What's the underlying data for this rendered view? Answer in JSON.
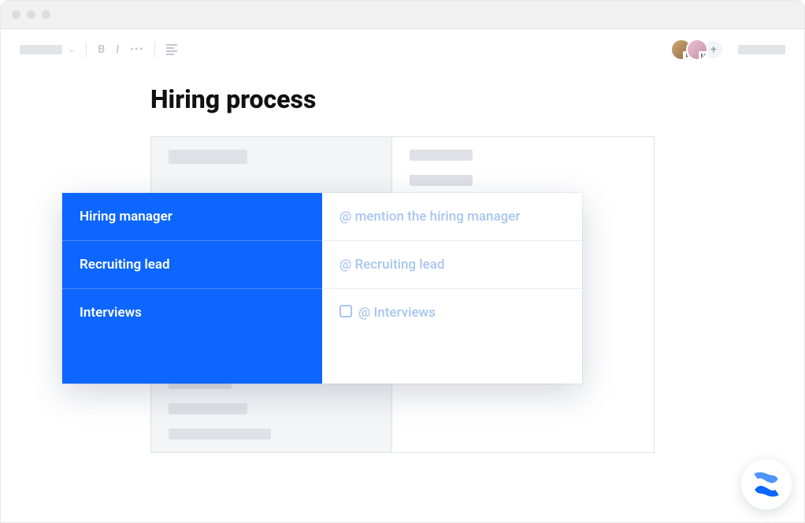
{
  "page": {
    "title": "Hiring process"
  },
  "toolbar": {
    "bold": "B",
    "italic": "I"
  },
  "collaborators": [
    {
      "initial": "R"
    },
    {
      "initial": "M"
    }
  ],
  "collaborator_add": "+",
  "overlay": {
    "rows": [
      {
        "label": "Hiring manager",
        "placeholder": "@ mention the hiring manager",
        "checkbox": false
      },
      {
        "label": "Recruiting lead",
        "placeholder": "@ Recruiting lead",
        "checkbox": false
      },
      {
        "label": "Interviews",
        "placeholder": "@ Interviews",
        "checkbox": true
      }
    ]
  },
  "colors": {
    "accent": "#0c66ff",
    "placeholder": "#a8c5f0"
  }
}
